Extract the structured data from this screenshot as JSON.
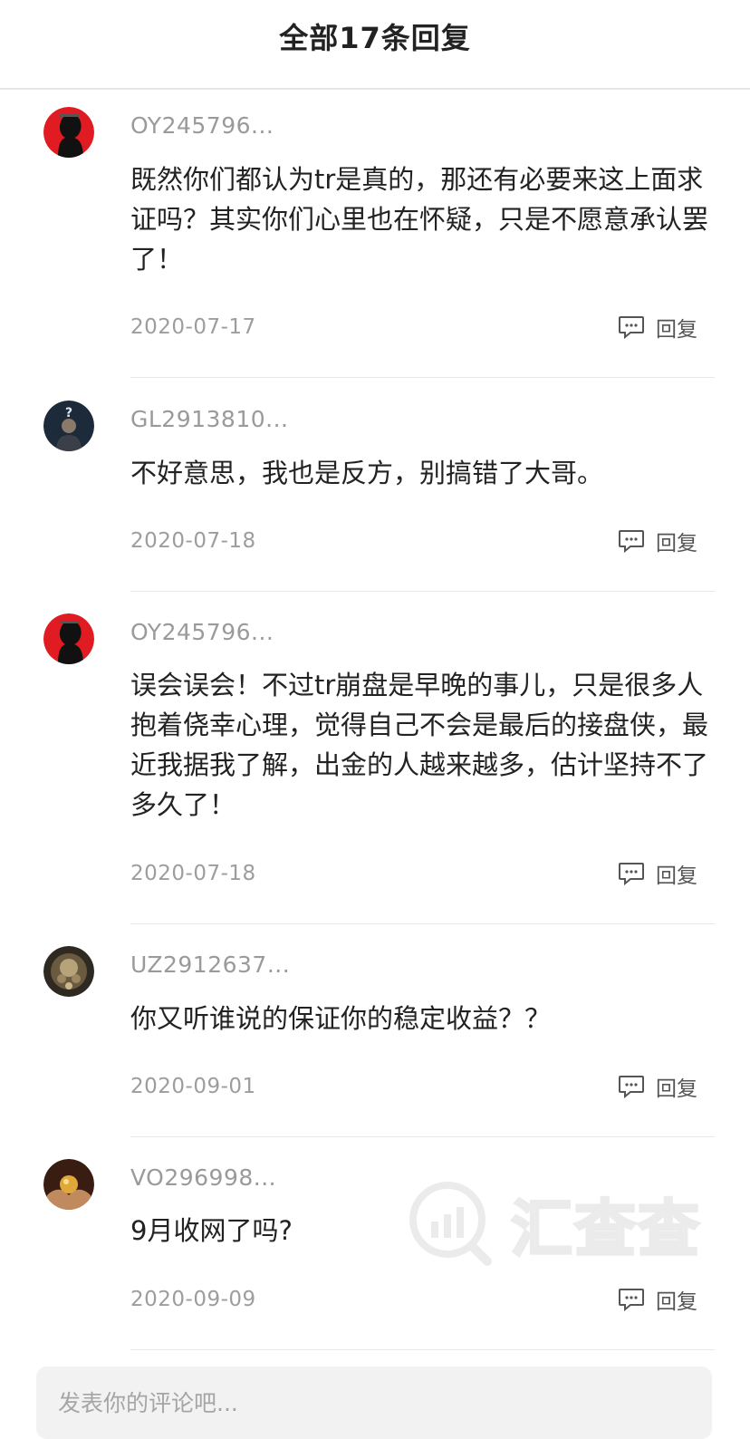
{
  "header": {
    "title": "全部17条回复"
  },
  "reply_label": "回复",
  "comments": [
    {
      "username": "OY245796...",
      "text": "既然你们都认为tr是真的，那还有必要来这上面求证吗？其实你们心里也在怀疑，只是不愿意承认罢了！",
      "date": "2020-07-17",
      "avatar": "red-silhouette-avatar"
    },
    {
      "username": "GL2913810...",
      "text": "不好意思，我也是反方，别搞错了大哥。",
      "date": "2020-07-18",
      "avatar": "question-mark-man-avatar"
    },
    {
      "username": "OY245796...",
      "text": "误会误会！不过tr崩盘是早晚的事儿，只是很多人抱着侥幸心理，觉得自己不会是最后的接盘侠，最近我据我了解，出金的人越来越多，估计坚持不了多久了！",
      "date": "2020-07-18",
      "avatar": "red-silhouette-avatar"
    },
    {
      "username": "UZ2912637...",
      "text": "你又听谁说的保证你的稳定收益？？",
      "date": "2020-09-01",
      "avatar": "ornate-statue-avatar"
    },
    {
      "username": "VO296998...",
      "text": "9月收网了吗?",
      "date": "2020-09-09",
      "avatar": "golden-orb-hands-avatar"
    }
  ],
  "watermark": {
    "text": "汇查查"
  },
  "comment_input": {
    "placeholder": "发表你的评论吧..."
  }
}
